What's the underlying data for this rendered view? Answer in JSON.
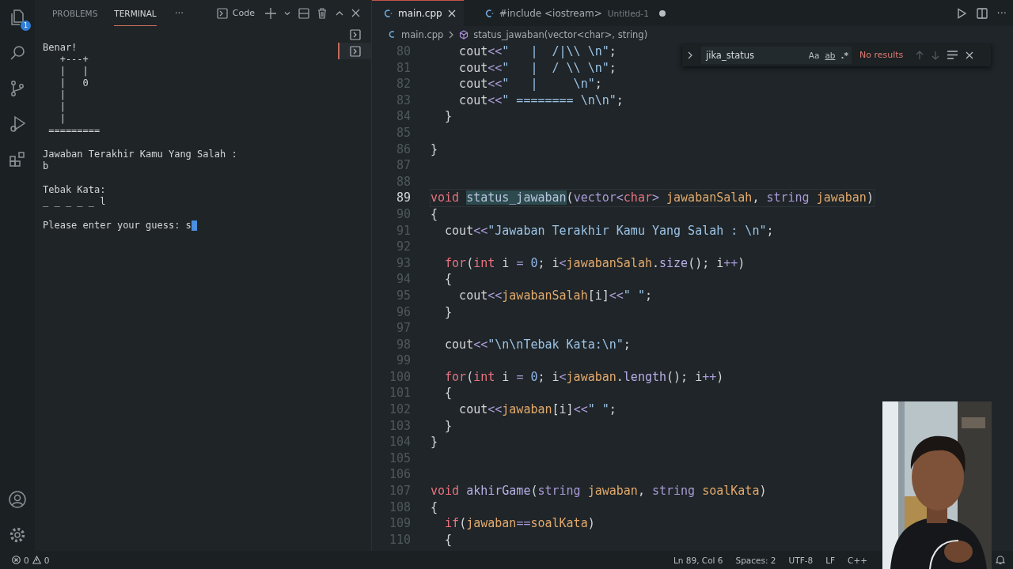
{
  "activity_bar": {
    "top": [
      {
        "kind": "explorer",
        "badge": "1"
      },
      {
        "kind": "search"
      },
      {
        "kind": "source-control"
      },
      {
        "kind": "run-debug"
      },
      {
        "kind": "extensions"
      }
    ],
    "bottom": [
      {
        "kind": "account"
      },
      {
        "kind": "settings"
      }
    ]
  },
  "panel": {
    "tabs": [
      {
        "label": "PROBLEMS",
        "selected": false
      },
      {
        "label": "TERMINAL",
        "selected": true
      }
    ],
    "more": "···",
    "terminal_name": "Code",
    "terminal_list": [
      {
        "selected": false
      },
      {
        "selected": true
      }
    ],
    "terminal": {
      "blocks": [
        [
          "Benar!",
          "   +---+",
          "   |   |",
          "   |   0",
          "   |",
          "   |",
          "   |",
          " ========="
        ],
        [
          "Jawaban Terakhir Kamu Yang Salah :",
          "b"
        ],
        [
          "Tebak Kata:",
          "_ _ _ _ _ l"
        ]
      ],
      "prompt": "Please enter your guess:",
      "typed": "s"
    }
  },
  "editor": {
    "tabs": [
      {
        "label": "main.cpp",
        "selected": true,
        "modified": false
      },
      {
        "label": "#include <iostream>",
        "description": "Untitled-1",
        "selected": false,
        "modified": true
      }
    ],
    "more": "···",
    "breadcrumb": {
      "file": "main.cpp",
      "symbol": "status_jawaban(vector<char>, string)"
    },
    "find": {
      "query": "jika_status",
      "options": [
        "Aa",
        "ab",
        ".*"
      ],
      "result": "No results"
    },
    "lines": [
      {
        "num": "80",
        "current": false,
        "tokens": [
          {
            "text": "    cout",
            "kind": "plain"
          },
          {
            "text": "<<",
            "kind": "operator"
          },
          {
            "text": "\"   |  /|\\\\ \\n\"",
            "kind": "string"
          },
          {
            "text": ";",
            "kind": "plain"
          }
        ]
      },
      {
        "num": "81",
        "current": false,
        "tokens": [
          {
            "text": "    cout",
            "kind": "plain"
          },
          {
            "text": "<<",
            "kind": "operator"
          },
          {
            "text": "\"   |  / \\\\ \\n\"",
            "kind": "string"
          },
          {
            "text": ";",
            "kind": "plain"
          }
        ]
      },
      {
        "num": "82",
        "current": false,
        "tokens": [
          {
            "text": "    cout",
            "kind": "plain"
          },
          {
            "text": "<<",
            "kind": "operator"
          },
          {
            "text": "\"   |     \\n\"",
            "kind": "string"
          },
          {
            "text": ";",
            "kind": "plain"
          }
        ]
      },
      {
        "num": "83",
        "current": false,
        "tokens": [
          {
            "text": "    cout",
            "kind": "plain"
          },
          {
            "text": "<<",
            "kind": "operator"
          },
          {
            "text": "\" ======== \\n\\n\"",
            "kind": "string"
          },
          {
            "text": ";",
            "kind": "plain"
          }
        ]
      },
      {
        "num": "84",
        "current": false,
        "tokens": [
          {
            "text": "  }",
            "kind": "plain"
          }
        ]
      },
      {
        "num": "85",
        "current": false
      },
      {
        "num": "86",
        "current": false,
        "tokens": [
          {
            "text": "}",
            "kind": "plain"
          }
        ]
      },
      {
        "num": "87",
        "current": false
      },
      {
        "num": "88",
        "current": false
      },
      {
        "num": "89",
        "current": true,
        "tokens": [
          {
            "text": "void ",
            "kind": "keyword"
          },
          {
            "text": "status_jawaban",
            "kind": "match"
          },
          {
            "text": "(",
            "kind": "plain"
          },
          {
            "text": "vector",
            "kind": "type"
          },
          {
            "text": "<",
            "kind": "operator"
          },
          {
            "text": "char",
            "kind": "keyword"
          },
          {
            "text": ">",
            "kind": "operator"
          },
          {
            "text": " jawabanSalah",
            "kind": "variable"
          },
          {
            "text": ", ",
            "kind": "plain"
          },
          {
            "text": "string",
            "kind": "type"
          },
          {
            "text": " jawaban",
            "kind": "variable"
          },
          {
            "text": ")",
            "kind": "plain"
          }
        ]
      },
      {
        "num": "90",
        "current": false,
        "tokens": [
          {
            "text": "{",
            "kind": "plain"
          }
        ]
      },
      {
        "num": "91",
        "current": false,
        "tokens": [
          {
            "text": "  cout",
            "kind": "plain"
          },
          {
            "text": "<<",
            "kind": "operator"
          },
          {
            "text": "\"Jawaban Terakhir Kamu Yang Salah : \\n\"",
            "kind": "string"
          },
          {
            "text": ";",
            "kind": "plain"
          }
        ]
      },
      {
        "num": "92",
        "current": false
      },
      {
        "num": "93",
        "current": false,
        "tokens": [
          {
            "text": "  for",
            "kind": "keyword"
          },
          {
            "text": "(",
            "kind": "plain"
          },
          {
            "text": "int",
            "kind": "keyword"
          },
          {
            "text": " i ",
            "kind": "plain"
          },
          {
            "text": "=",
            "kind": "operator"
          },
          {
            "text": " 0",
            "kind": "number"
          },
          {
            "text": "; i",
            "kind": "plain"
          },
          {
            "text": "<",
            "kind": "operator"
          },
          {
            "text": "jawabanSalah",
            "kind": "variable"
          },
          {
            "text": ".",
            "kind": "plain"
          },
          {
            "text": "size",
            "kind": "function"
          },
          {
            "text": "(); i",
            "kind": "plain"
          },
          {
            "text": "++",
            "kind": "operator"
          },
          {
            "text": ")",
            "kind": "plain"
          }
        ]
      },
      {
        "num": "94",
        "current": false,
        "tokens": [
          {
            "text": "  {",
            "kind": "plain"
          }
        ]
      },
      {
        "num": "95",
        "current": false,
        "tokens": [
          {
            "text": "    cout",
            "kind": "plain"
          },
          {
            "text": "<<",
            "kind": "operator"
          },
          {
            "text": "jawabanSalah",
            "kind": "variable"
          },
          {
            "text": "[i]",
            "kind": "plain"
          },
          {
            "text": "<<",
            "kind": "operator"
          },
          {
            "text": "\" \"",
            "kind": "string"
          },
          {
            "text": ";",
            "kind": "plain"
          }
        ]
      },
      {
        "num": "96",
        "current": false,
        "tokens": [
          {
            "text": "  }",
            "kind": "plain"
          }
        ]
      },
      {
        "num": "97",
        "current": false
      },
      {
        "num": "98",
        "current": false,
        "tokens": [
          {
            "text": "  cout",
            "kind": "plain"
          },
          {
            "text": "<<",
            "kind": "operator"
          },
          {
            "text": "\"\\n\\nTebak Kata:\\n\"",
            "kind": "string"
          },
          {
            "text": ";",
            "kind": "plain"
          }
        ]
      },
      {
        "num": "99",
        "current": false
      },
      {
        "num": "100",
        "current": false,
        "tokens": [
          {
            "text": "  for",
            "kind": "keyword"
          },
          {
            "text": "(",
            "kind": "plain"
          },
          {
            "text": "int",
            "kind": "keyword"
          },
          {
            "text": " i ",
            "kind": "plain"
          },
          {
            "text": "=",
            "kind": "operator"
          },
          {
            "text": " 0",
            "kind": "number"
          },
          {
            "text": "; i",
            "kind": "plain"
          },
          {
            "text": "<",
            "kind": "operator"
          },
          {
            "text": "jawaban",
            "kind": "variable"
          },
          {
            "text": ".",
            "kind": "plain"
          },
          {
            "text": "length",
            "kind": "function"
          },
          {
            "text": "(); i",
            "kind": "plain"
          },
          {
            "text": "++",
            "kind": "operator"
          },
          {
            "text": ")",
            "kind": "plain"
          }
        ]
      },
      {
        "num": "101",
        "current": false,
        "tokens": [
          {
            "text": "  {",
            "kind": "plain"
          }
        ]
      },
      {
        "num": "102",
        "current": false,
        "tokens": [
          {
            "text": "    cout",
            "kind": "plain"
          },
          {
            "text": "<<",
            "kind": "operator"
          },
          {
            "text": "jawaban",
            "kind": "variable"
          },
          {
            "text": "[i]",
            "kind": "plain"
          },
          {
            "text": "<<",
            "kind": "operator"
          },
          {
            "text": "\" \"",
            "kind": "string"
          },
          {
            "text": ";",
            "kind": "plain"
          }
        ]
      },
      {
        "num": "103",
        "current": false,
        "tokens": [
          {
            "text": "  }",
            "kind": "plain"
          }
        ]
      },
      {
        "num": "104",
        "current": false,
        "tokens": [
          {
            "text": "}",
            "kind": "plain"
          }
        ]
      },
      {
        "num": "105",
        "current": false
      },
      {
        "num": "106",
        "current": false
      },
      {
        "num": "107",
        "current": false,
        "tokens": [
          {
            "text": "void ",
            "kind": "keyword"
          },
          {
            "text": "akhirGame",
            "kind": "function"
          },
          {
            "text": "(",
            "kind": "plain"
          },
          {
            "text": "string",
            "kind": "type"
          },
          {
            "text": " jawaban",
            "kind": "variable"
          },
          {
            "text": ", ",
            "kind": "plain"
          },
          {
            "text": "string",
            "kind": "type"
          },
          {
            "text": " soalKata",
            "kind": "variable"
          },
          {
            "text": ")",
            "kind": "plain"
          }
        ]
      },
      {
        "num": "108",
        "current": false,
        "tokens": [
          {
            "text": "{",
            "kind": "plain"
          }
        ]
      },
      {
        "num": "109",
        "current": false,
        "tokens": [
          {
            "text": "  if",
            "kind": "keyword"
          },
          {
            "text": "(",
            "kind": "plain"
          },
          {
            "text": "jawaban",
            "kind": "variable"
          },
          {
            "text": "==",
            "kind": "operator"
          },
          {
            "text": "soalKata",
            "kind": "variable"
          },
          {
            "text": ")",
            "kind": "plain"
          }
        ]
      },
      {
        "num": "110",
        "current": false,
        "tokens": [
          {
            "text": "  {",
            "kind": "plain"
          }
        ]
      }
    ]
  },
  "status_bar": {
    "errors": "0",
    "warnings": "0",
    "items": [
      "Ln 89, Col 6",
      "Spaces: 2",
      "UTF-8",
      "LF",
      "C++"
    ]
  }
}
